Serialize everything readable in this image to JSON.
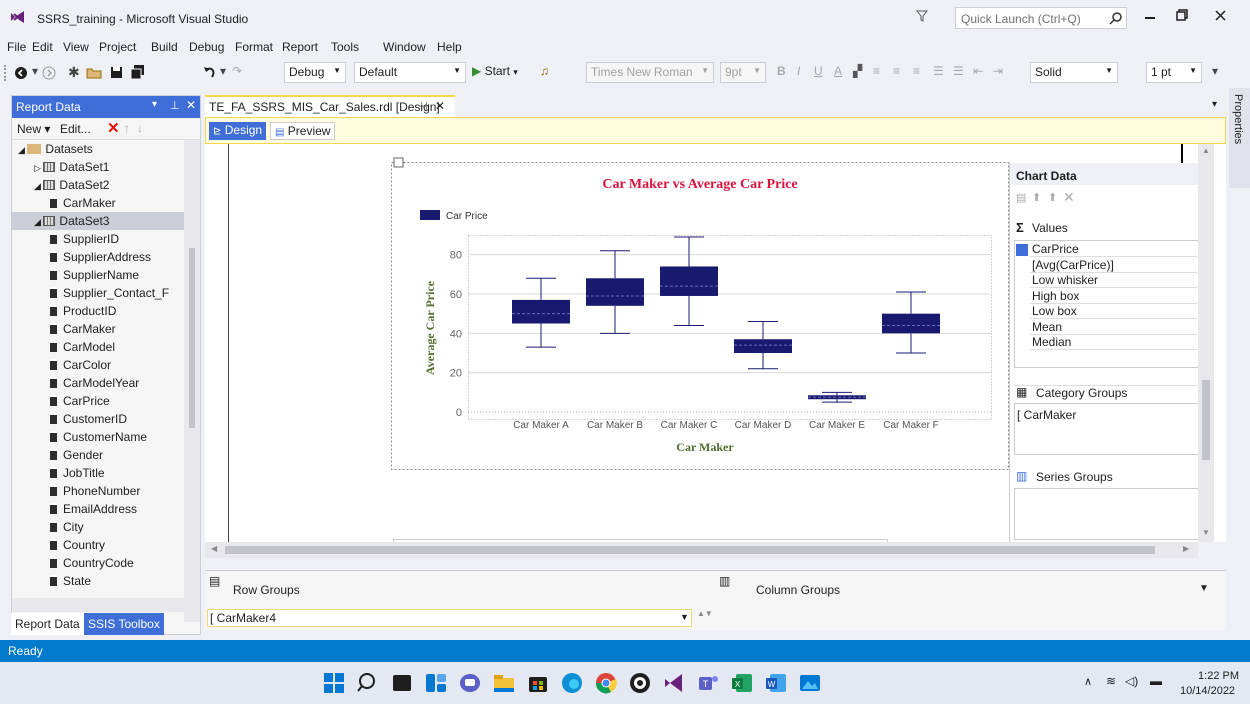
{
  "window": {
    "title": "SSRS_training - Microsoft Visual Studio",
    "quick_launch_placeholder": "Quick Launch (Ctrl+Q)"
  },
  "menu": [
    "File",
    "Edit",
    "View",
    "Project",
    "Build",
    "Debug",
    "Format",
    "Report",
    "Tools",
    "Window",
    "Help"
  ],
  "toolbar": {
    "config": "Debug",
    "platform": "Default",
    "start_label": "Start",
    "font": "Times New Roman",
    "font_size": "9pt",
    "line_style": "Solid",
    "line_width": "1 pt"
  },
  "report_data": {
    "title": "Report Data",
    "new_label": "New",
    "edit_label": "Edit...",
    "tree": [
      {
        "label": "Datasets",
        "level": 0,
        "kind": "folder"
      },
      {
        "label": "DataSet1",
        "level": 1,
        "kind": "dataset"
      },
      {
        "label": "DataSet2",
        "level": 1,
        "kind": "dataset"
      },
      {
        "label": "CarMaker",
        "level": 2,
        "kind": "field"
      },
      {
        "label": "DataSet3",
        "level": 1,
        "kind": "dataset"
      },
      {
        "label": "SupplierID",
        "level": 2,
        "kind": "field"
      },
      {
        "label": "SupplierAddress",
        "level": 2,
        "kind": "field"
      },
      {
        "label": "SupplierName",
        "level": 2,
        "kind": "field"
      },
      {
        "label": "Supplier_Contact_F",
        "level": 2,
        "kind": "field"
      },
      {
        "label": "ProductID",
        "level": 2,
        "kind": "field"
      },
      {
        "label": "CarMaker",
        "level": 2,
        "kind": "field"
      },
      {
        "label": "CarModel",
        "level": 2,
        "kind": "field"
      },
      {
        "label": "CarColor",
        "level": 2,
        "kind": "field"
      },
      {
        "label": "CarModelYear",
        "level": 2,
        "kind": "field"
      },
      {
        "label": "CarPrice",
        "level": 2,
        "kind": "field"
      },
      {
        "label": "CustomerID",
        "level": 2,
        "kind": "field"
      },
      {
        "label": "CustomerName",
        "level": 2,
        "kind": "field"
      },
      {
        "label": "Gender",
        "level": 2,
        "kind": "field"
      },
      {
        "label": "JobTitle",
        "level": 2,
        "kind": "field"
      },
      {
        "label": "PhoneNumber",
        "level": 2,
        "kind": "field"
      },
      {
        "label": "EmailAddress",
        "level": 2,
        "kind": "field"
      },
      {
        "label": "City",
        "level": 2,
        "kind": "field"
      },
      {
        "label": "Country",
        "level": 2,
        "kind": "field"
      },
      {
        "label": "CountryCode",
        "level": 2,
        "kind": "field"
      },
      {
        "label": "State",
        "level": 2,
        "kind": "field"
      }
    ],
    "bottom_tabs": [
      "Report Data",
      "SSIS Toolbox"
    ]
  },
  "document": {
    "tab_label": "TE_FA_SSRS_MIS_Car_Sales.rdl [Design]",
    "design_tab": "Design",
    "preview_tab": "Preview"
  },
  "chart_panel": {
    "title": "Chart Data",
    "values_heading": "Values",
    "values": [
      "CarPrice",
      "[Avg(CarPrice)]",
      "Low whisker",
      "High box",
      "Low box",
      "Mean",
      "Median"
    ],
    "category_heading": "Category Groups",
    "category": "CarMaker",
    "series_heading": "Series Groups"
  },
  "groups": {
    "row_groups": "Row Groups",
    "column_groups": "Column Groups",
    "row_value": "CarMaker4"
  },
  "status": "Ready",
  "properties_label": "Properties",
  "clock": {
    "time": "1:22 PM",
    "date": "10/14/2022"
  },
  "chart_data": {
    "type": "boxplot",
    "title": "Car Maker vs Average Car Price",
    "xlabel": "Car Maker",
    "ylabel": "Average Car Price",
    "legend": "Car Price",
    "legend_position": "top-left",
    "ylim": [
      0,
      90
    ],
    "yticks": [
      0,
      20,
      40,
      60,
      80
    ],
    "categories": [
      "Car Maker A",
      "Car Maker B",
      "Car Maker C",
      "Car Maker D",
      "Car Maker E",
      "Car Maker F"
    ],
    "boxes": [
      {
        "low_whisker": 33,
        "low_box": 45,
        "median": 50,
        "high_box": 57,
        "high_whisker": 68
      },
      {
        "low_whisker": 40,
        "low_box": 54,
        "median": 59,
        "high_box": 68,
        "high_whisker": 82
      },
      {
        "low_whisker": 44,
        "low_box": 59,
        "median": 64,
        "high_box": 74,
        "high_whisker": 89
      },
      {
        "low_whisker": 22,
        "low_box": 30,
        "median": 34,
        "high_box": 37,
        "high_whisker": 46
      },
      {
        "low_whisker": 5,
        "low_box": 6.5,
        "median": 7.5,
        "high_box": 8.5,
        "high_whisker": 10
      },
      {
        "low_whisker": 30,
        "low_box": 40,
        "median": 44,
        "high_box": 50,
        "high_whisker": 61
      }
    ],
    "color": "#191970",
    "title_color": "#dc143c",
    "axis_title_color": "#556b2f",
    "grid": true
  }
}
